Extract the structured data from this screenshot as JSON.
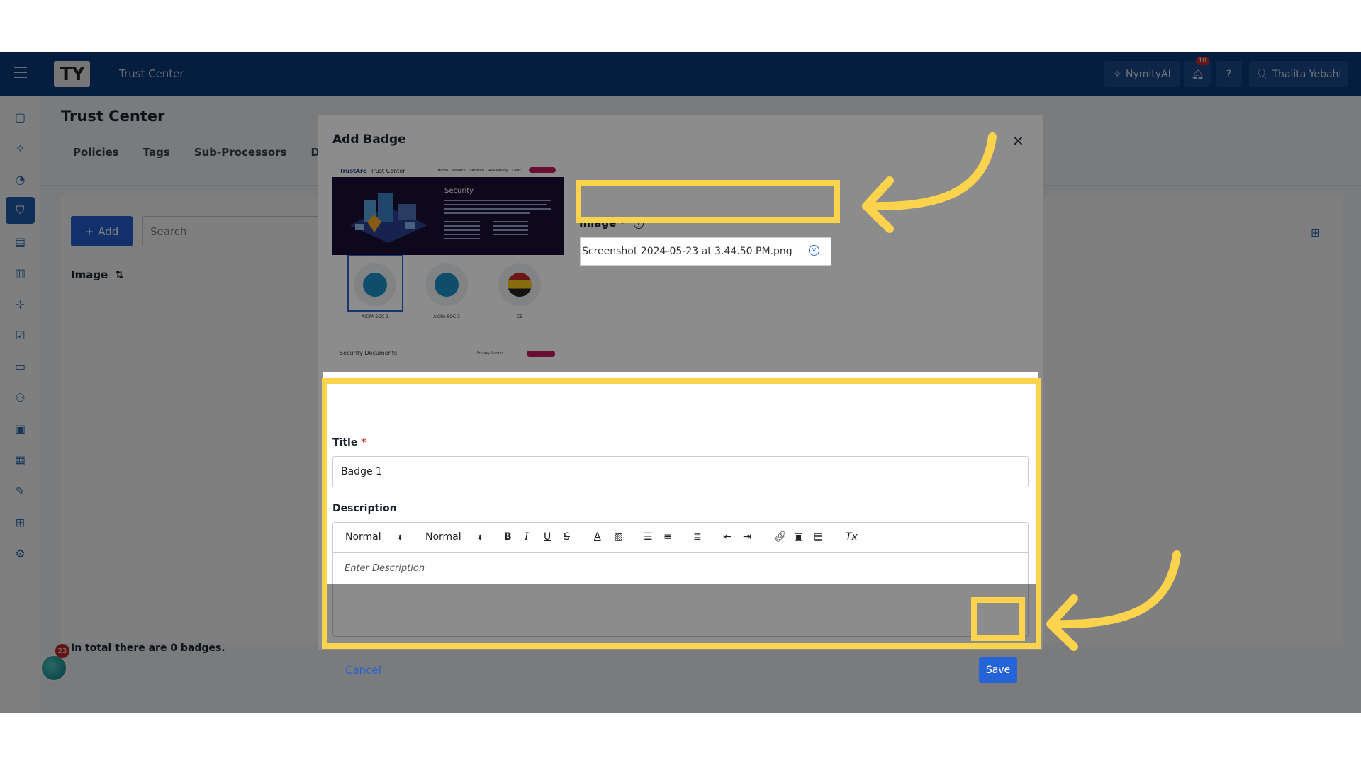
{
  "header": {
    "logo_text": "TY",
    "app_title": "Trust Center",
    "ai_button": "NymityAI",
    "notification_count": "10",
    "user_name": "Thalita Yebahi"
  },
  "page": {
    "title": "Trust Center",
    "tabs": [
      "Policies",
      "Tags",
      "Sub-Processors",
      "Docu"
    ],
    "add_label": "Add",
    "search_placeholder": "Search",
    "column_image": "Image",
    "total_text": "In total there are 0 badges.",
    "chat_badge_count": "23"
  },
  "modal": {
    "title": "Add Badge",
    "image_label": "Image",
    "file_name": "Screenshot 2024-05-23 at 3.44.50 PM.png",
    "title_label": "Title",
    "title_value": "Badge 1",
    "description_label": "Description",
    "format_select_1": "Normal",
    "format_select_2": "Normal",
    "description_placeholder": "Enter Description",
    "cancel_label": "Cancel",
    "save_label": "Save",
    "required_mark": "*"
  },
  "preview": {
    "brand": "TrustArc",
    "brand_sub": "Trust Center",
    "nav": [
      "Home",
      "Privacy",
      "Security",
      "Availability",
      "Laws"
    ],
    "hero_title": "Security",
    "badges": [
      "AICPA SOC 2",
      "AICPA SOC 3",
      "C5"
    ],
    "footer": "Security Documents",
    "footer_select": "Privacy Center"
  },
  "colors": {
    "topbar": "#0b3a7e",
    "primary": "#2563d8",
    "highlight": "#fcd34d"
  }
}
